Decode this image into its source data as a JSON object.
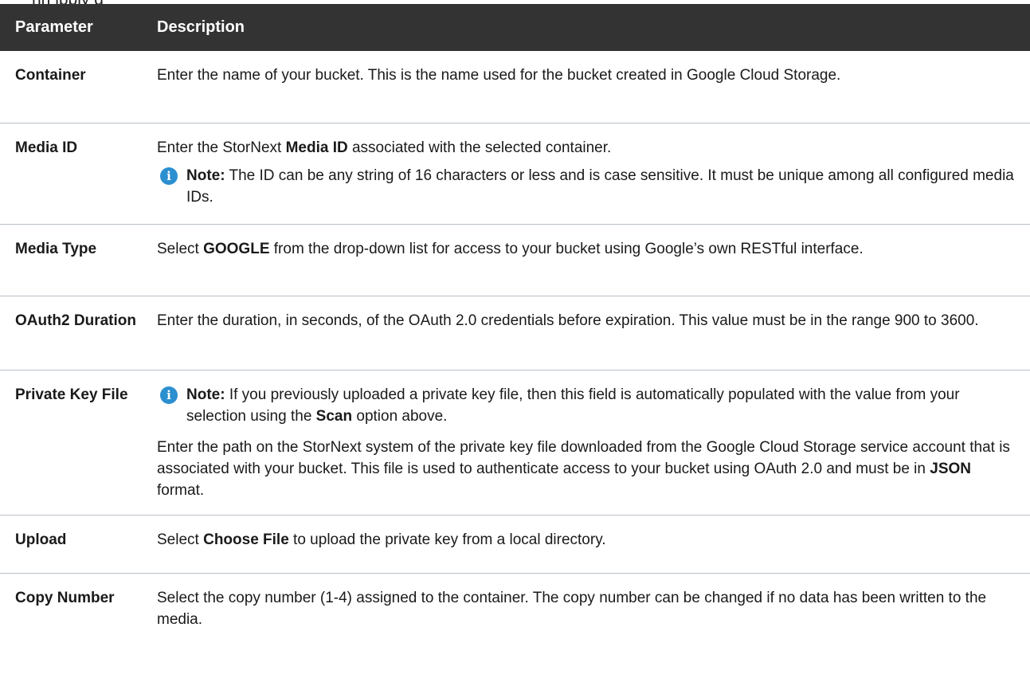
{
  "caption_fragment": "nn    ipply         g",
  "table": {
    "headers": {
      "parameter": "Parameter",
      "description": "Description"
    },
    "rows": {
      "container": {
        "param": "Container",
        "desc": "Enter the name of your bucket. This is the name used for the bucket created in Google Cloud Storage."
      },
      "media_id": {
        "param": "Media ID",
        "desc_a": "Enter the StorNext ",
        "desc_bold": "Media ID",
        "desc_b": " associated with the selected container.",
        "note_label": "Note:",
        "note_text": " The ID can be any string of 16 characters or less and is case sensitive. It must be unique among all configured media IDs."
      },
      "media_type": {
        "param": "Media Type",
        "desc_a": "Select ",
        "desc_bold": "GOOGLE",
        "desc_b": " from the drop-down list for access to your bucket using Google’s own RESTful interface."
      },
      "oauth2": {
        "param": "OAuth2 Duration",
        "desc": "Enter the duration, in seconds, of the OAuth 2.0 credentials before expiration. This value must be in the range 900 to 3600."
      },
      "private_key": {
        "param": "Private Key File",
        "note_label": "Note:",
        "note_text_a": " If you previously uploaded a private key file, then this field is automatically populated with the value from your selection using the ",
        "note_bold": "Scan",
        "note_text_b": " option above.",
        "desc_a": "Enter the path on the StorNext system of the private key file downloaded from the Google Cloud Storage service account that is associated with your bucket. This file is used to authenticate access to your bucket using OAuth 2.0 and must be in ",
        "desc_bold": "JSON",
        "desc_b": " format."
      },
      "upload": {
        "param": "Upload",
        "desc_a": "Select ",
        "desc_bold": "Choose File",
        "desc_b": " to upload the private key from a local directory."
      },
      "copy_number": {
        "param": "Copy Number",
        "desc": "Select the copy number (1-4) assigned to the container. The copy number can be changed if no data has been written to the media."
      }
    }
  },
  "icons": {
    "note": "info-circle-icon",
    "note_glyph": "i",
    "note_color": "#2b8fd0"
  },
  "colors": {
    "header_bg": "#333333",
    "header_text": "#ffffff",
    "row_divider": "#b8c0c8"
  }
}
